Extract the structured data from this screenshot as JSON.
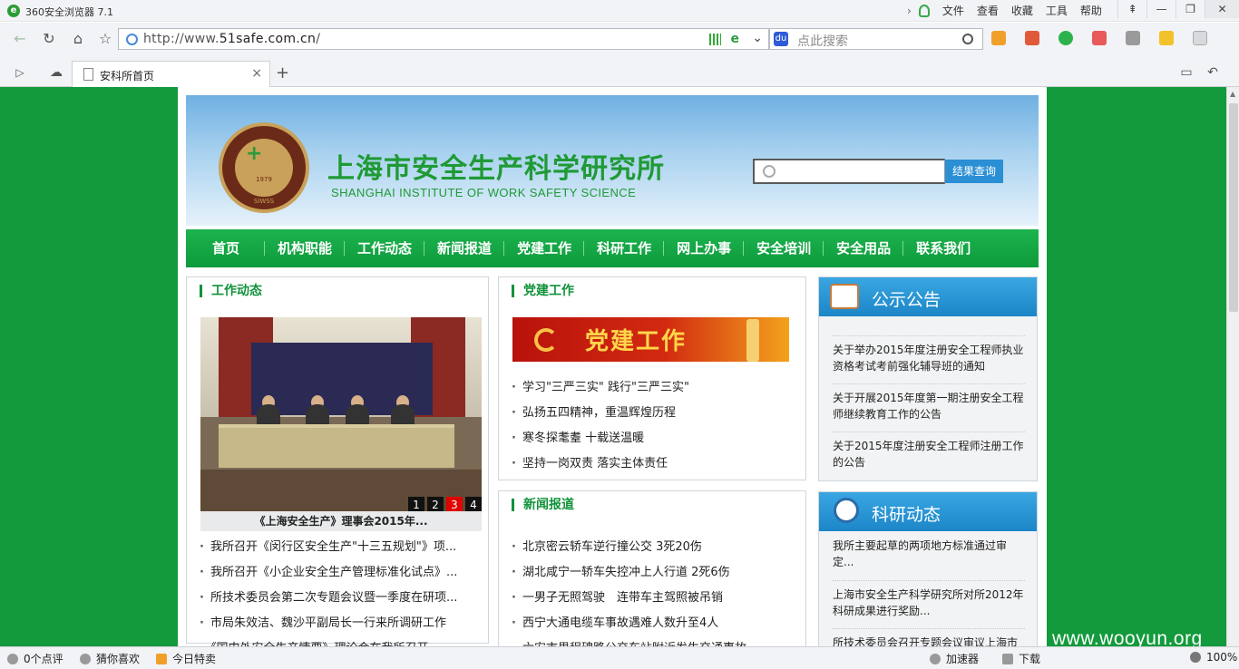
{
  "browser": {
    "title": "360安全浏览器 7.1",
    "menus": [
      "文件",
      "查看",
      "收藏",
      "工具",
      "帮助"
    ],
    "url_prefix": "http://www.",
    "url_host": "51safe.com.cn",
    "url_suffix": "/",
    "search_placeholder": "点此搜索",
    "tab_title": "安科所首页",
    "window_buttons": [
      "⇞",
      "—",
      "❐",
      "✕"
    ],
    "status": {
      "comments": "0个点评",
      "guess": "猜你喜欢",
      "deals": "今日特卖",
      "accelerator": "加速器",
      "download": "下载",
      "zoom": "100%"
    }
  },
  "site": {
    "name_cn": "上海市安全生产科学研究所",
    "name_en": "SHANGHAI INSTITUTE OF WORK SAFETY SCIENCE",
    "logo_year": "1979",
    "logo_abbr": "SIWSS",
    "search_button": "结果查询",
    "nav": [
      "首页",
      "机构职能",
      "工作动态",
      "新闻报道",
      "党建工作",
      "科研工作",
      "网上办事",
      "安全培训",
      "安全用品",
      "联系我们"
    ]
  },
  "work_news": {
    "title": "工作动态",
    "slide_caption": "《上海安全生产》理事会2015年...",
    "slide_dots": [
      "1",
      "2",
      "3",
      "4"
    ],
    "active_dot": 2,
    "items": [
      "我所召开《闵行区安全生产\"十三五规划\"》项...",
      "我所召开《小企业安全生产管理标准化试点》...",
      "所技术委员会第二次专题会议暨一季度在研项...",
      "市局朱效洁、魏沙平副局长一行来所调研工作",
      "《国内外安全生产情要》理论会在我所召开"
    ]
  },
  "party": {
    "title": "党建工作",
    "banner_text": "党建工作",
    "items": [
      "学习\"三严三实\" 践行\"三严三实\"",
      "弘扬五四精神，重温辉煌历程",
      "寒冬探耄耋 十载送温暖",
      "坚持一岗双责 落实主体责任"
    ]
  },
  "news_report": {
    "title": "新闻报道",
    "items": [
      "北京密云轿车逆行撞公交 3死20伤",
      "湖北咸宁一轿车失控冲上人行道 2死6伤",
      "一男子无照驾驶　连带车主驾照被吊销",
      "西宁大通电缆车事故遇难人数升至4人",
      "六安市里程碑路公交车站附近发生交通事故"
    ]
  },
  "notice": {
    "title": "公示公告",
    "items": [
      "关于举办2015年度注册安全工程师执业资格考试考前强化辅导班的通知",
      "关于开展2015年度第一期注册安全工程师继续教育工作的公告",
      "关于2015年度注册安全工程师注册工作的公告"
    ]
  },
  "research": {
    "title": "科研动态",
    "items": [
      "我所主要起草的两项地方标准通过审定...",
      "上海市安全生产科学研究所对所2012年科研成果进行奖励...",
      "所技术委员会召开专题会议审议上海市安全生产..."
    ]
  },
  "watermark": "www.wooyun.org"
}
